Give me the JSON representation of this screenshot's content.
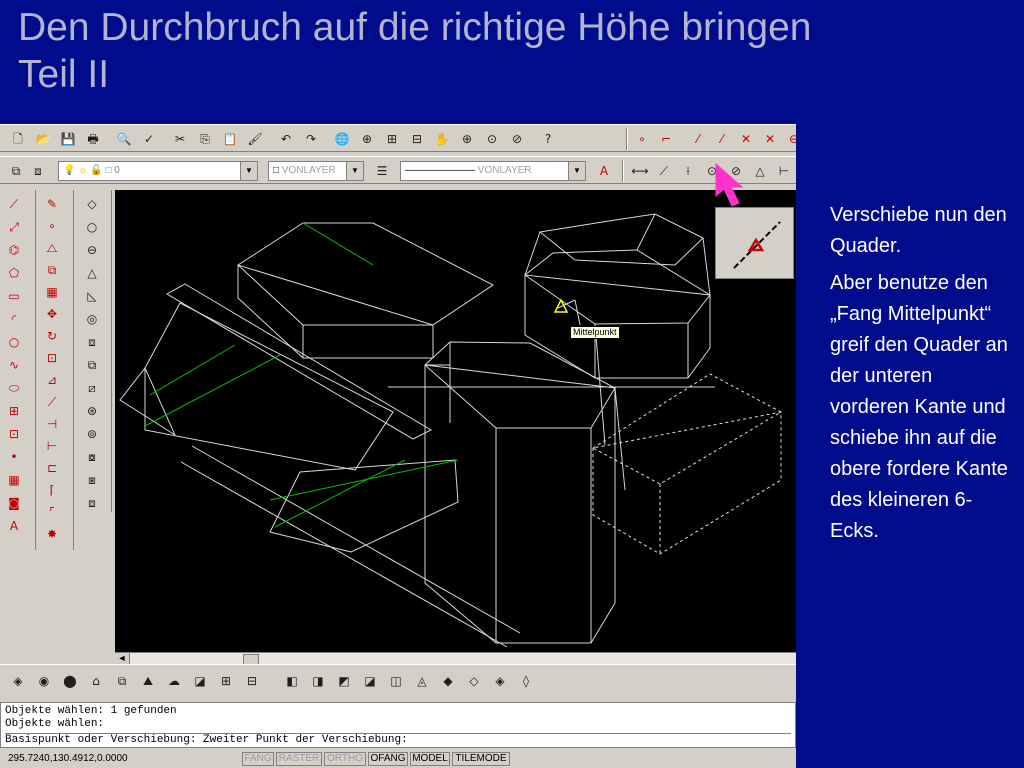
{
  "slide": {
    "title_line1": "Den Durchbruch auf die richtige Höhe bringen",
    "title_line2": "Teil II",
    "description_p1": "Verschiebe nun den Quader.",
    "description_p2": "Aber benutze den „Fang Mittelpunkt“ greif den Quader an der unteren vorderen Kante und schiebe ihn auf die obere fordere Kante des kleineren 6-Ecks."
  },
  "toolbar_standard": {
    "icons": [
      "new-icon",
      "open-icon",
      "save-icon",
      "print-icon",
      "preview-icon",
      "spell-icon",
      "cut-icon",
      "copy-icon",
      "paste-icon",
      "matchprop-icon",
      "undo-icon",
      "redo-icon",
      "hyperlink-icon",
      "snap-tracking-icon",
      "snap-from-icon",
      "snap-endpoint-icon",
      "pan-icon",
      "zoom-icon",
      "zoom-window-icon",
      "zoom-previous-icon",
      "help-icon"
    ],
    "glyphs": [
      "🗋",
      "📂",
      "💾",
      "🖶",
      "🔍",
      "✓",
      "✂",
      "⎘",
      "📋",
      "🖌",
      "↶",
      "↷",
      "🌐",
      "⊕",
      "⊞",
      "⊟",
      "✋",
      "⊕",
      "⊙",
      "⊘",
      "?"
    ]
  },
  "toolbar_object_snap": {
    "icons": [
      "snap-tracking-icon",
      "snap-from-icon",
      "snap-endpoint-icon",
      "snap-midpoint-icon",
      "snap-intersection-icon",
      "snap-apparent-icon",
      "snap-extension-icon"
    ],
    "glyphs": [
      "∘",
      "⌐",
      "⁄",
      "⁄",
      "✕",
      "✕",
      "⊖"
    ]
  },
  "toolbar_layers": {
    "layer_value": "0",
    "color_value": "VONLAYER",
    "linetype_value": "VONLAYER",
    "dim_glyphs": [
      "⟷",
      "⟋",
      "⟊",
      "⊙",
      "⊘",
      "△",
      "⊢"
    ]
  },
  "left_toolbar_draw": {
    "icons": [
      "line-icon",
      "construction-line-icon",
      "polyline-icon",
      "polygon-icon",
      "rectangle-icon",
      "arc-icon",
      "circle-icon",
      "spline-icon",
      "ellipse-icon",
      "insert-block-icon",
      "make-block-icon",
      "point-icon",
      "hatch-icon",
      "region-icon",
      "text-icon"
    ],
    "glyphs": [
      "⟋",
      "⤢",
      "⌬",
      "⬠",
      "▭",
      "◜",
      "○",
      "∿",
      "⬭",
      "⊞",
      "⊡",
      "•",
      "▦",
      "◙",
      "A"
    ]
  },
  "left_toolbar_modify": {
    "icons": [
      "erase-icon",
      "copy-object-icon",
      "mirror-icon",
      "offset-icon",
      "array-icon",
      "move-icon",
      "rotate-icon",
      "scale-icon",
      "stretch-icon",
      "lengthen-icon",
      "trim-icon",
      "extend-icon",
      "break-icon",
      "chamfer-icon",
      "fillet-icon",
      "explode-icon"
    ],
    "glyphs": [
      "✎",
      "∘",
      "⧍",
      "⧉",
      "▦",
      "✥",
      "↻",
      "⊡",
      "⊿",
      "⟋",
      "⊣",
      "⊢",
      "⊏",
      "⌈",
      "⌜",
      "✸"
    ]
  },
  "left_toolbar_solids": {
    "icons": [
      "box-icon",
      "sphere-icon",
      "cylinder-icon",
      "cone-icon",
      "wedge-icon",
      "torus-icon",
      "extrude-icon",
      "revolve-icon",
      "slice-icon",
      "section-icon",
      "interference-icon",
      "setup-drawing-icon",
      "setup-view-icon",
      "setup-profile-icon"
    ],
    "glyphs": [
      "◇",
      "○",
      "⊖",
      "△",
      "◺",
      "◎",
      "⧈",
      "⧉",
      "⧄",
      "⊛",
      "⊚",
      "⧇",
      "⧆",
      "⧈"
    ]
  },
  "toolbar_bottom": {
    "icons": [
      "shade-icon",
      "render-icon",
      "scene-icon",
      "light-icon",
      "material-icon",
      "landscape-icon",
      "fog-icon",
      "background-icon",
      "mapping-icon",
      "statistics-icon",
      "view-front-icon",
      "view-back-icon",
      "view-left-icon",
      "view-right-icon",
      "view-top-icon",
      "view-bottom-icon",
      "iso-sw-icon",
      "iso-se-icon",
      "iso-ne-icon",
      "iso-nw-icon"
    ],
    "glyphs": [
      "◈",
      "◉",
      "⬤",
      "⌂",
      "⧉",
      "⛰",
      "☁",
      "◪",
      "⊞",
      "⊟",
      "◧",
      "◨",
      "◩",
      "◪",
      "◫",
      "◬",
      "◆",
      "◇",
      "◈",
      "◊"
    ]
  },
  "tooltip": {
    "label": "Mittelpunkt"
  },
  "command_line": {
    "line1": "Objekte wählen: 1 gefunden",
    "line2": "Objekte wählen:",
    "line3": "Basispunkt oder Verschiebung: Zweiter Punkt der Verschiebung:"
  },
  "status_bar": {
    "coordinates": "295.7240,130.4912,0.0000",
    "buttons": [
      {
        "label": "FANG",
        "state": "off"
      },
      {
        "label": "RASTER",
        "state": "off"
      },
      {
        "label": "ORTHO",
        "state": "off"
      },
      {
        "label": "OFANG",
        "state": "on"
      },
      {
        "label": "MODEL",
        "state": "on"
      },
      {
        "label": "TILEMODE",
        "state": "on"
      }
    ]
  },
  "colors": {
    "slide_background": "#000c8c",
    "title_text": "#b4b4ce",
    "drawing_background": "#000000",
    "wire_lines": "#d8d8d8",
    "highlight_edges": "#00c000",
    "snap_marker": "#ffff00",
    "cursor_pointer": "#ff33cc"
  }
}
